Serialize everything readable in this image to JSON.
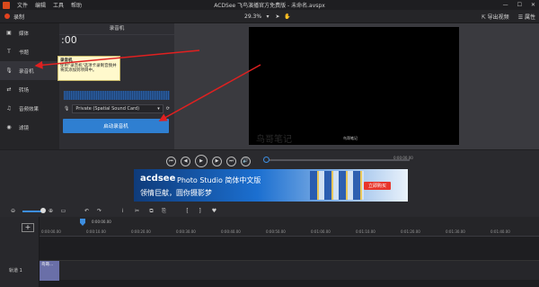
{
  "app": {
    "window_title": "ACDSee 飞鸟演播官方免费版 - 未命名.avspx",
    "menu": [
      "文件",
      "编辑",
      "工具",
      "帮助"
    ]
  },
  "toolbar": {
    "record_label": "录制",
    "zoom_value": "29.3%",
    "export_label": "导出视频",
    "properties_label": "属性"
  },
  "sidebar": {
    "items": [
      {
        "label": "媒体",
        "icon": "media-icon"
      },
      {
        "label": "书题",
        "icon": "text-icon"
      },
      {
        "label": "录音机",
        "icon": "microphone-icon"
      },
      {
        "label": "转场",
        "icon": "transition-icon"
      },
      {
        "label": "音频效果",
        "icon": "audio-effect-icon"
      },
      {
        "label": "滤镜",
        "icon": "filter-icon"
      }
    ]
  },
  "recorder": {
    "title": "录音机",
    "timer": ":00",
    "device": "Private (Spatial Sound Card)",
    "start_button": "启动录音机",
    "tooltip_title": "录音机",
    "tooltip_body": "使用\"录音机\"选项卡录制音频并将其添加到项目中。"
  },
  "preview": {
    "screen_caption": "鸟哥笔记",
    "watermark": "鸟哥笔记"
  },
  "playback": {
    "time": "0:00:00.00"
  },
  "banner": {
    "logo": "acdsee",
    "title": "Photo Studio 简体中文版",
    "subtitle": "领情巨献，圆你摄影梦",
    "buy_label": "立即购买"
  },
  "timeline": {
    "playhead_time": "0:00:00.00",
    "ticks": [
      "0:00:00.00",
      "0:00:10.00",
      "0:00:20.00",
      "0:00:30.00",
      "0:00:40.00",
      "0:00:50.00",
      "0:01:00.00",
      "0:01:10.00",
      "0:01:20.00",
      "0:01:30.00",
      "0:01:40.00"
    ],
    "track_label": "轨道 1",
    "clip_label": "鸟哥..."
  }
}
